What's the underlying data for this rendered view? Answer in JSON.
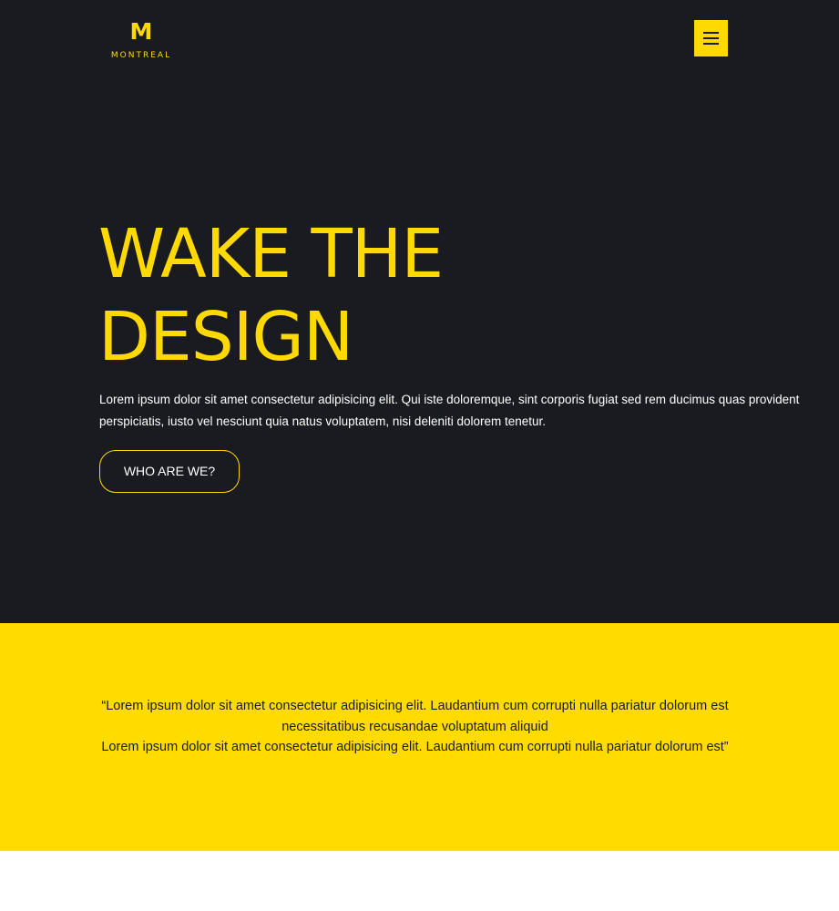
{
  "header": {
    "logo_mark": "M",
    "logo_text": "MONTREAL",
    "menu_icon": "hamburger-menu-icon"
  },
  "hero": {
    "title_line1": "WAKE THE",
    "title_line2": "DESIGN",
    "text": "Lorem ipsum dolor sit amet consectetur adipisicing elit. Qui iste doloremque, sint corporis fugiat sed rem ducimus quas provident perspiciatis, iusto vel nesciunt quia natus voluptatem, nisi deleniti dolorem tenetur.",
    "cta_label": "WHO ARE WE?"
  },
  "quote": {
    "line1": "“Lorem ipsum dolor sit amet consectetur adipisicing elit. Laudantium cum corrupti nulla pariatur dolorum est necessitatibus recusandae voluptatum aliquid",
    "line2": "Lorem ipsum dolor sit amet consectetur adipisicing elit. Laudantium cum corrupti nulla pariatur dolorum est”"
  },
  "colors": {
    "dark_background": "#1a1b21",
    "accent_yellow": "#ffd900",
    "quote_background": "#ffdb00",
    "text_white": "#ffffff"
  }
}
